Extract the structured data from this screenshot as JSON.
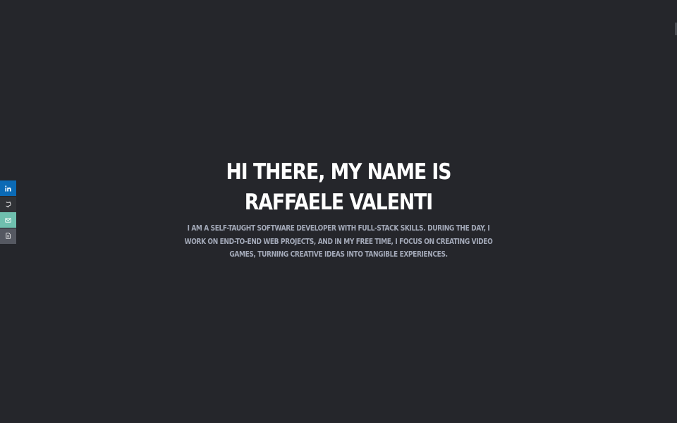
{
  "hero": {
    "title": "Hi there, my name is Raffaele Valenti",
    "description": "I am a self-taught software developer with full-stack skills. During the day, I work on end-to-end web projects, and in my free time, I focus on creating video games, turning creative ideas into tangible experiences."
  },
  "social": {
    "items": [
      {
        "name": "linkedin",
        "icon": "linkedin-icon",
        "color": "#0b6ab5"
      },
      {
        "name": "github",
        "icon": "github-icon",
        "color": "#303236"
      },
      {
        "name": "email",
        "icon": "mail-icon",
        "color": "#6fbfae"
      },
      {
        "name": "resume",
        "icon": "document-icon",
        "color": "#555861"
      }
    ]
  },
  "colors": {
    "background": "#25262b",
    "title": "#ffffff",
    "description": "#a3a9b8"
  }
}
